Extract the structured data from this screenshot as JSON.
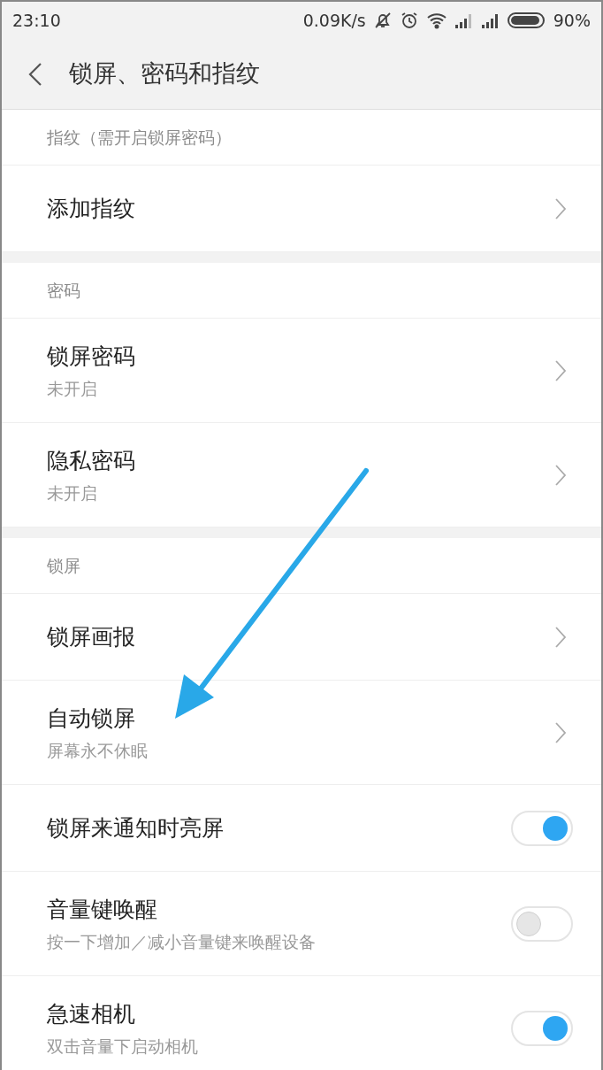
{
  "status_bar": {
    "time": "23:10",
    "speed": "0.09K/s",
    "battery": "90%"
  },
  "header": {
    "title": "锁屏、密码和指纹"
  },
  "sections": [
    {
      "title": "指纹（需开启锁屏密码）",
      "rows": [
        {
          "kind": "link",
          "title": "添加指纹"
        }
      ]
    },
    {
      "title": "密码",
      "rows": [
        {
          "kind": "link",
          "title": "锁屏密码",
          "subtitle": "未开启"
        },
        {
          "kind": "link",
          "title": "隐私密码",
          "subtitle": "未开启"
        }
      ]
    },
    {
      "title": "锁屏",
      "rows": [
        {
          "kind": "link",
          "title": "锁屏画报"
        },
        {
          "kind": "link",
          "title": "自动锁屏",
          "subtitle": "屏幕永不休眠"
        },
        {
          "kind": "toggle",
          "title": "锁屏来通知时亮屏",
          "on": true
        },
        {
          "kind": "toggle",
          "title": "音量键唤醒",
          "subtitle": "按一下增加／减小音量键来唤醒设备",
          "on": false
        },
        {
          "kind": "toggle",
          "title": "急速相机",
          "subtitle": "双击音量下启动相机",
          "on": true
        }
      ]
    }
  ]
}
